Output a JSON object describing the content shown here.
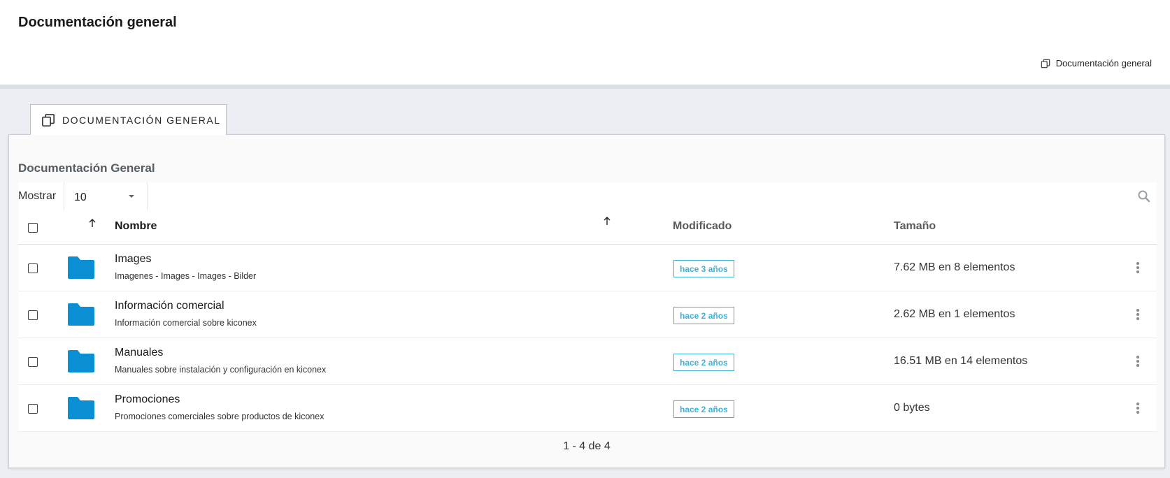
{
  "header": {
    "title": "Documentación general",
    "breadcrumb": "Documentación general"
  },
  "tab": {
    "label": "DOCUMENTACIÓN GENERAL"
  },
  "panel": {
    "title": "Documentación General",
    "show_label": "Mostrar",
    "page_size": "10"
  },
  "table": {
    "columns": {
      "name": "Nombre",
      "modified": "Modificado",
      "size": "Tamaño"
    },
    "rows": [
      {
        "name": "Images",
        "description": "Imagenes - Images - Images - Bilder",
        "modified": "hace 3 años",
        "size": "7.62 MB en 8 elementos"
      },
      {
        "name": "Información comercial",
        "description": "Información comercial sobre kiconex",
        "modified": "hace 2 años",
        "size": "2.62 MB en 1 elementos"
      },
      {
        "name": "Manuales",
        "description": "Manuales sobre instalación y configuración en kiconex",
        "modified": "hace 2 años",
        "size": "16.51 MB en 14 elementos"
      },
      {
        "name": "Promociones",
        "description": "Promociones comerciales sobre productos de kiconex",
        "modified": "hace 2 años",
        "size": "0 bytes"
      }
    ]
  },
  "pagination": {
    "text": "1 - 4 de 4"
  },
  "colors": {
    "folder": "#0a8fd4",
    "badge": "#3fb0d8"
  },
  "icons": [
    "copy-icon",
    "search-icon",
    "folder-icon",
    "sort-arrow-icon",
    "kebab-menu-icon",
    "chevron-down-icon"
  ]
}
